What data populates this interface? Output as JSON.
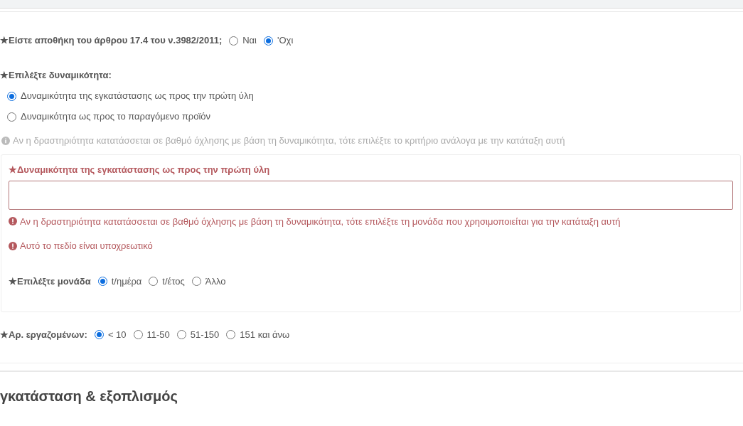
{
  "warehouse_question": {
    "label": "★Είστε αποθήκη του άρθρου 17.4 του ν.3982/2011;",
    "options": [
      {
        "label": "Ναι",
        "selected": false
      },
      {
        "label": "'Οχι",
        "selected": true
      }
    ]
  },
  "capacity_choice": {
    "label": "★Επιλέξτε δυναμικότητα:",
    "options": [
      {
        "label": "Δυναμικότητα της εγκατάστασης ως προς την πρώτη ύλη",
        "selected": true
      },
      {
        "label": "Δυναμικότητα ως προς το παραγόμενο προϊόν",
        "selected": false
      }
    ],
    "hint": "Αν η δραστηριότητα κατατάσσεται σε βαθμό όχλησης με βάση τη δυναμικότητα, τότε επιλέξτε το κριτήριο ανάλογα με την κατάταξη αυτή"
  },
  "capacity_panel": {
    "label": "★Δυναμικότητα της εγκατάστασης ως προς την πρώτη ύλη",
    "invalid": true,
    "hint": "Αν η δραστηριότητα κατατάσσεται σε βαθμό όχλησης με βάση τη δυναμικότητα, τότε επιλέξτε τη μονάδα που χρησιμοποιείται για την κατάταξη αυτή",
    "error": "Αυτό το πεδίο είναι υποχρεωτικό",
    "unit_label": "★Επιλέξτε μονάδα",
    "units": [
      {
        "label": "t/ημέρα",
        "selected": true
      },
      {
        "label": "t/έτος",
        "selected": false
      },
      {
        "label": "Άλλο",
        "selected": false
      }
    ]
  },
  "employees": {
    "label": "★Αρ. εργαζομένων:",
    "options": [
      {
        "label": "< 10",
        "selected": true
      },
      {
        "label": "11-50",
        "selected": false
      },
      {
        "label": "51-150",
        "selected": false
      },
      {
        "label": "151 και άνω",
        "selected": false
      }
    ]
  },
  "section_heading": "γκατάσταση & εξοπλισμός"
}
